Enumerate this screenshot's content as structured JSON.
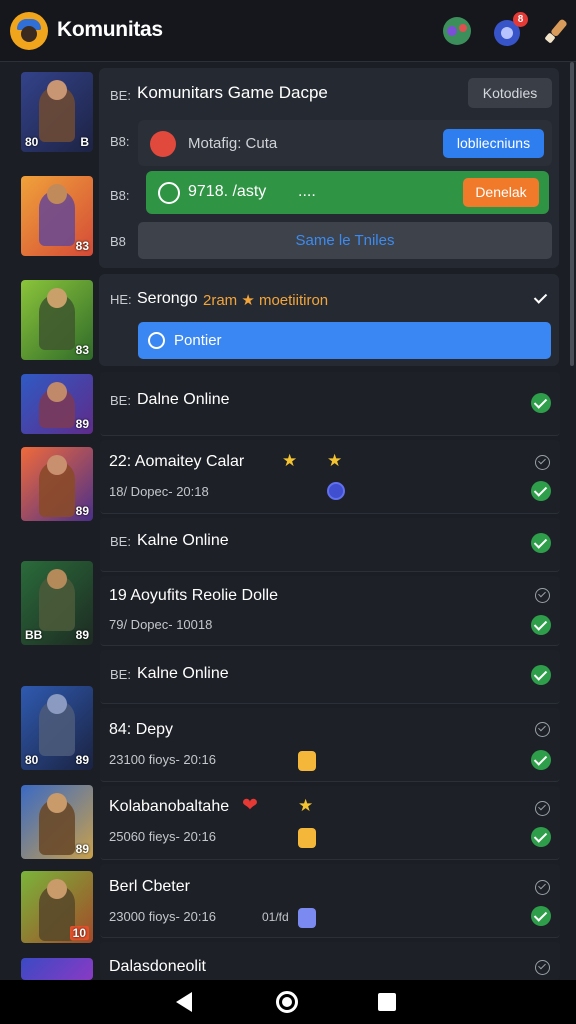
{
  "header": {
    "title": "Komunitas"
  },
  "group": {
    "title": "Komunitars Game Dacpe",
    "header_button": "Kotodies",
    "message": {
      "text": "Motafig: Cuta",
      "button": "lobliecniuns"
    },
    "status": {
      "text": "9718. /asty",
      "dots": "....",
      "button": "Denelak"
    },
    "secondary": "Same le Tniles",
    "side_labels": [
      "BE:",
      "B8:",
      "B8:",
      "B8"
    ]
  },
  "mission": {
    "idx": "HE:",
    "text_a": "Serongo",
    "text_b": "2ram ★ moetiitiron",
    "button": "Pontier"
  },
  "rows": [
    {
      "idx": "BE:",
      "title": "Dalne Online"
    },
    {
      "title": "22: Aomaitey Calar",
      "subtitle": "18/ Dopec- 20:18"
    },
    {
      "idx": "BE:",
      "title": "Kalne Online"
    },
    {
      "title": "19  Aoyufits Reolie Dolle",
      "subtitle": "79/ Dopec- 10018"
    },
    {
      "idx": "BE:",
      "title": "Kalne Online"
    },
    {
      "title": "84: Depy",
      "subtitle": "23100 fioys- 20:16"
    },
    {
      "title": "Kolabanobaltahe",
      "subtitle": "25060 fieys- 20:16"
    },
    {
      "title": "Berl Cbeter",
      "subtitle": "23000 fioys- 20:16",
      "note": "01/fd"
    },
    {
      "title": "Dalasdoneolit"
    }
  ],
  "thumbs": [
    {
      "a": "80",
      "b": "B"
    },
    {
      "b": "83"
    },
    {
      "b": "83"
    },
    {
      "b": "89"
    },
    {
      "b": "89"
    },
    {
      "a": "BB",
      "b": "89"
    },
    {
      "a": "80",
      "b": "89"
    },
    {
      "b": "89"
    },
    {
      "b": "10"
    }
  ],
  "colors": {
    "green": "#2e9e4a",
    "blue": "#2f7ef0",
    "orange": "#f07a2a",
    "gold": "#f3c332"
  }
}
